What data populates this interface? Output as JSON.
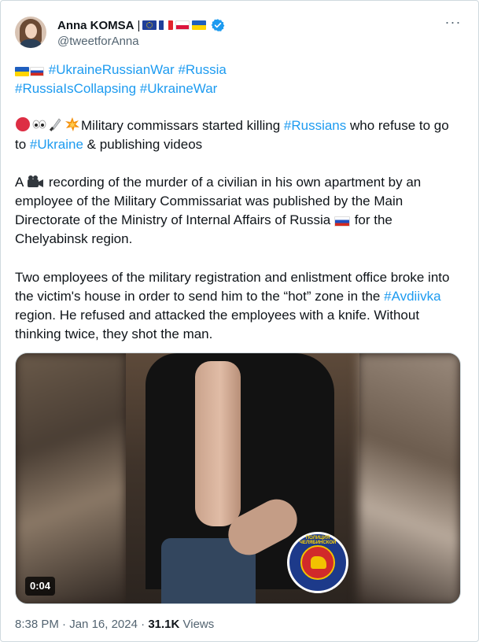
{
  "author": {
    "display_name": "Anna KOMSA",
    "separator": "|",
    "handle": "@tweetforAnna",
    "flags": [
      "eu",
      "fr",
      "pl",
      "ua"
    ],
    "verified": true
  },
  "more_icon": "more-horizontal-icon",
  "tweet": {
    "hashtags_line1": "#UkraineRussianWar",
    "hashtags_line1b": "#Russia",
    "hashtags_line2a": "#RussiaIsCollapsing",
    "hashtags_line2b": "#UkraineWar",
    "p2_text_a": "Military commissars started killing ",
    "p2_tag_russians": "#Russians",
    "p2_text_b": " who refuse to go to ",
    "p2_tag_ukraine": "#Ukraine",
    "p2_text_c": " & publishing videos",
    "p3_text_a": "A ",
    "p3_text_b": " recording of the murder of a civilian in his own apartment by an employee of the Military Commissariat was published by the Main Directorate of the Ministry of Internal Affairs of Russia ",
    "p3_text_c": " for the Chelyabinsk region.",
    "p4_text_a": "Two employees of the military registration and enlistment office broke into the victim's house in order to send him to the “hot” zone in the ",
    "p4_tag_avdiivka": "#Avdiivka",
    "p4_text_b": " region. He refused and attacked the employees with a knife. Without thinking twice, they shot the man."
  },
  "media": {
    "duration": "0:04",
    "emblem_text": "ПОЛИЦИЯ ЧЕЛЯБИНСКОЙ"
  },
  "meta": {
    "time": "8:38 PM",
    "dot": "·",
    "date": "Jan 16, 2024",
    "views_count": "31.1K",
    "views_label": "Views"
  },
  "colors": {
    "link": "#1d9bf0",
    "text": "#0f1419",
    "muted": "#536471",
    "verified": "#1d9bf0"
  }
}
